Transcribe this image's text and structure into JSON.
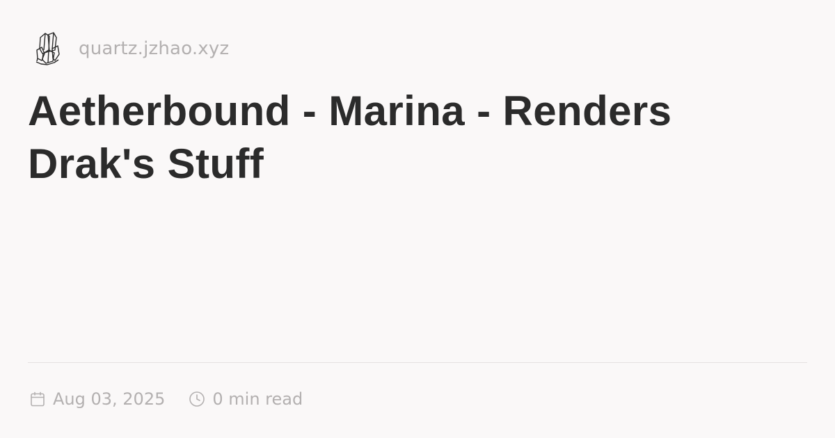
{
  "site": {
    "domain": "quartz.jzhao.xyz"
  },
  "page": {
    "title": "Aetherbound - Marina - Renders Drak's Stuff"
  },
  "meta": {
    "date": "Aug 03, 2025",
    "reading_time": "0 min read"
  },
  "icons": {
    "logo": "crystal-logo",
    "date": "calendar-icon",
    "reading_time": "clock-icon"
  },
  "colors": {
    "background": "#faf8f8",
    "title": "#2b2b2b",
    "muted": "#b3b0b0",
    "divider": "#e4e1e1"
  }
}
